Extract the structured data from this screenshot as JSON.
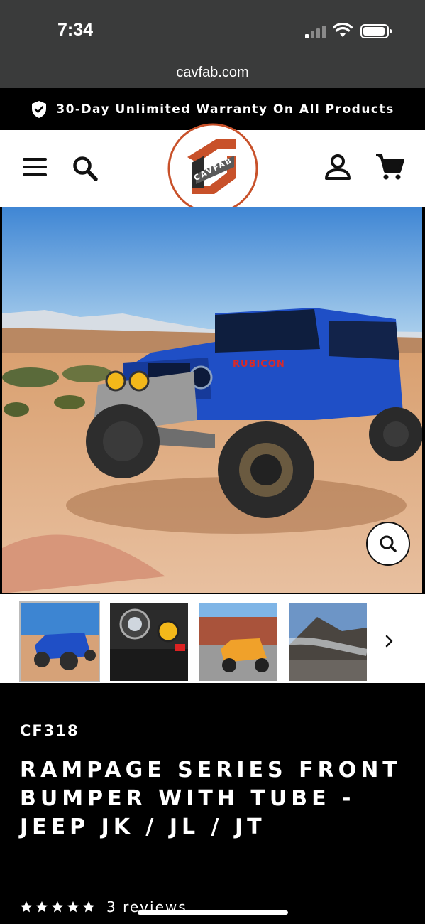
{
  "status_bar": {
    "time": "7:34"
  },
  "browser": {
    "url": "cavfab.com"
  },
  "announcement": {
    "text": "30-Day Unlimited Warranty On All Products"
  },
  "header": {
    "logo_text": "CAVFAB",
    "brand_color": "#c8512a"
  },
  "gallery": {
    "thumbnails": [
      {
        "name": "blue-jeep-desert"
      },
      {
        "name": "bumper-closeup"
      },
      {
        "name": "orange-jeep-store"
      },
      {
        "name": "jeep-mountain"
      }
    ]
  },
  "product": {
    "sku": "CF318",
    "title": "RAMPAGE SERIES FRONT BUMPER WITH TUBE - JEEP JK / JL / JT",
    "rating_stars": 5,
    "reviews_label": "3 reviews"
  },
  "icons": [
    "shield-check-icon",
    "menu-icon",
    "search-icon",
    "account-icon",
    "cart-icon",
    "zoom-icon",
    "chevron-right-icon",
    "star-icon"
  ]
}
